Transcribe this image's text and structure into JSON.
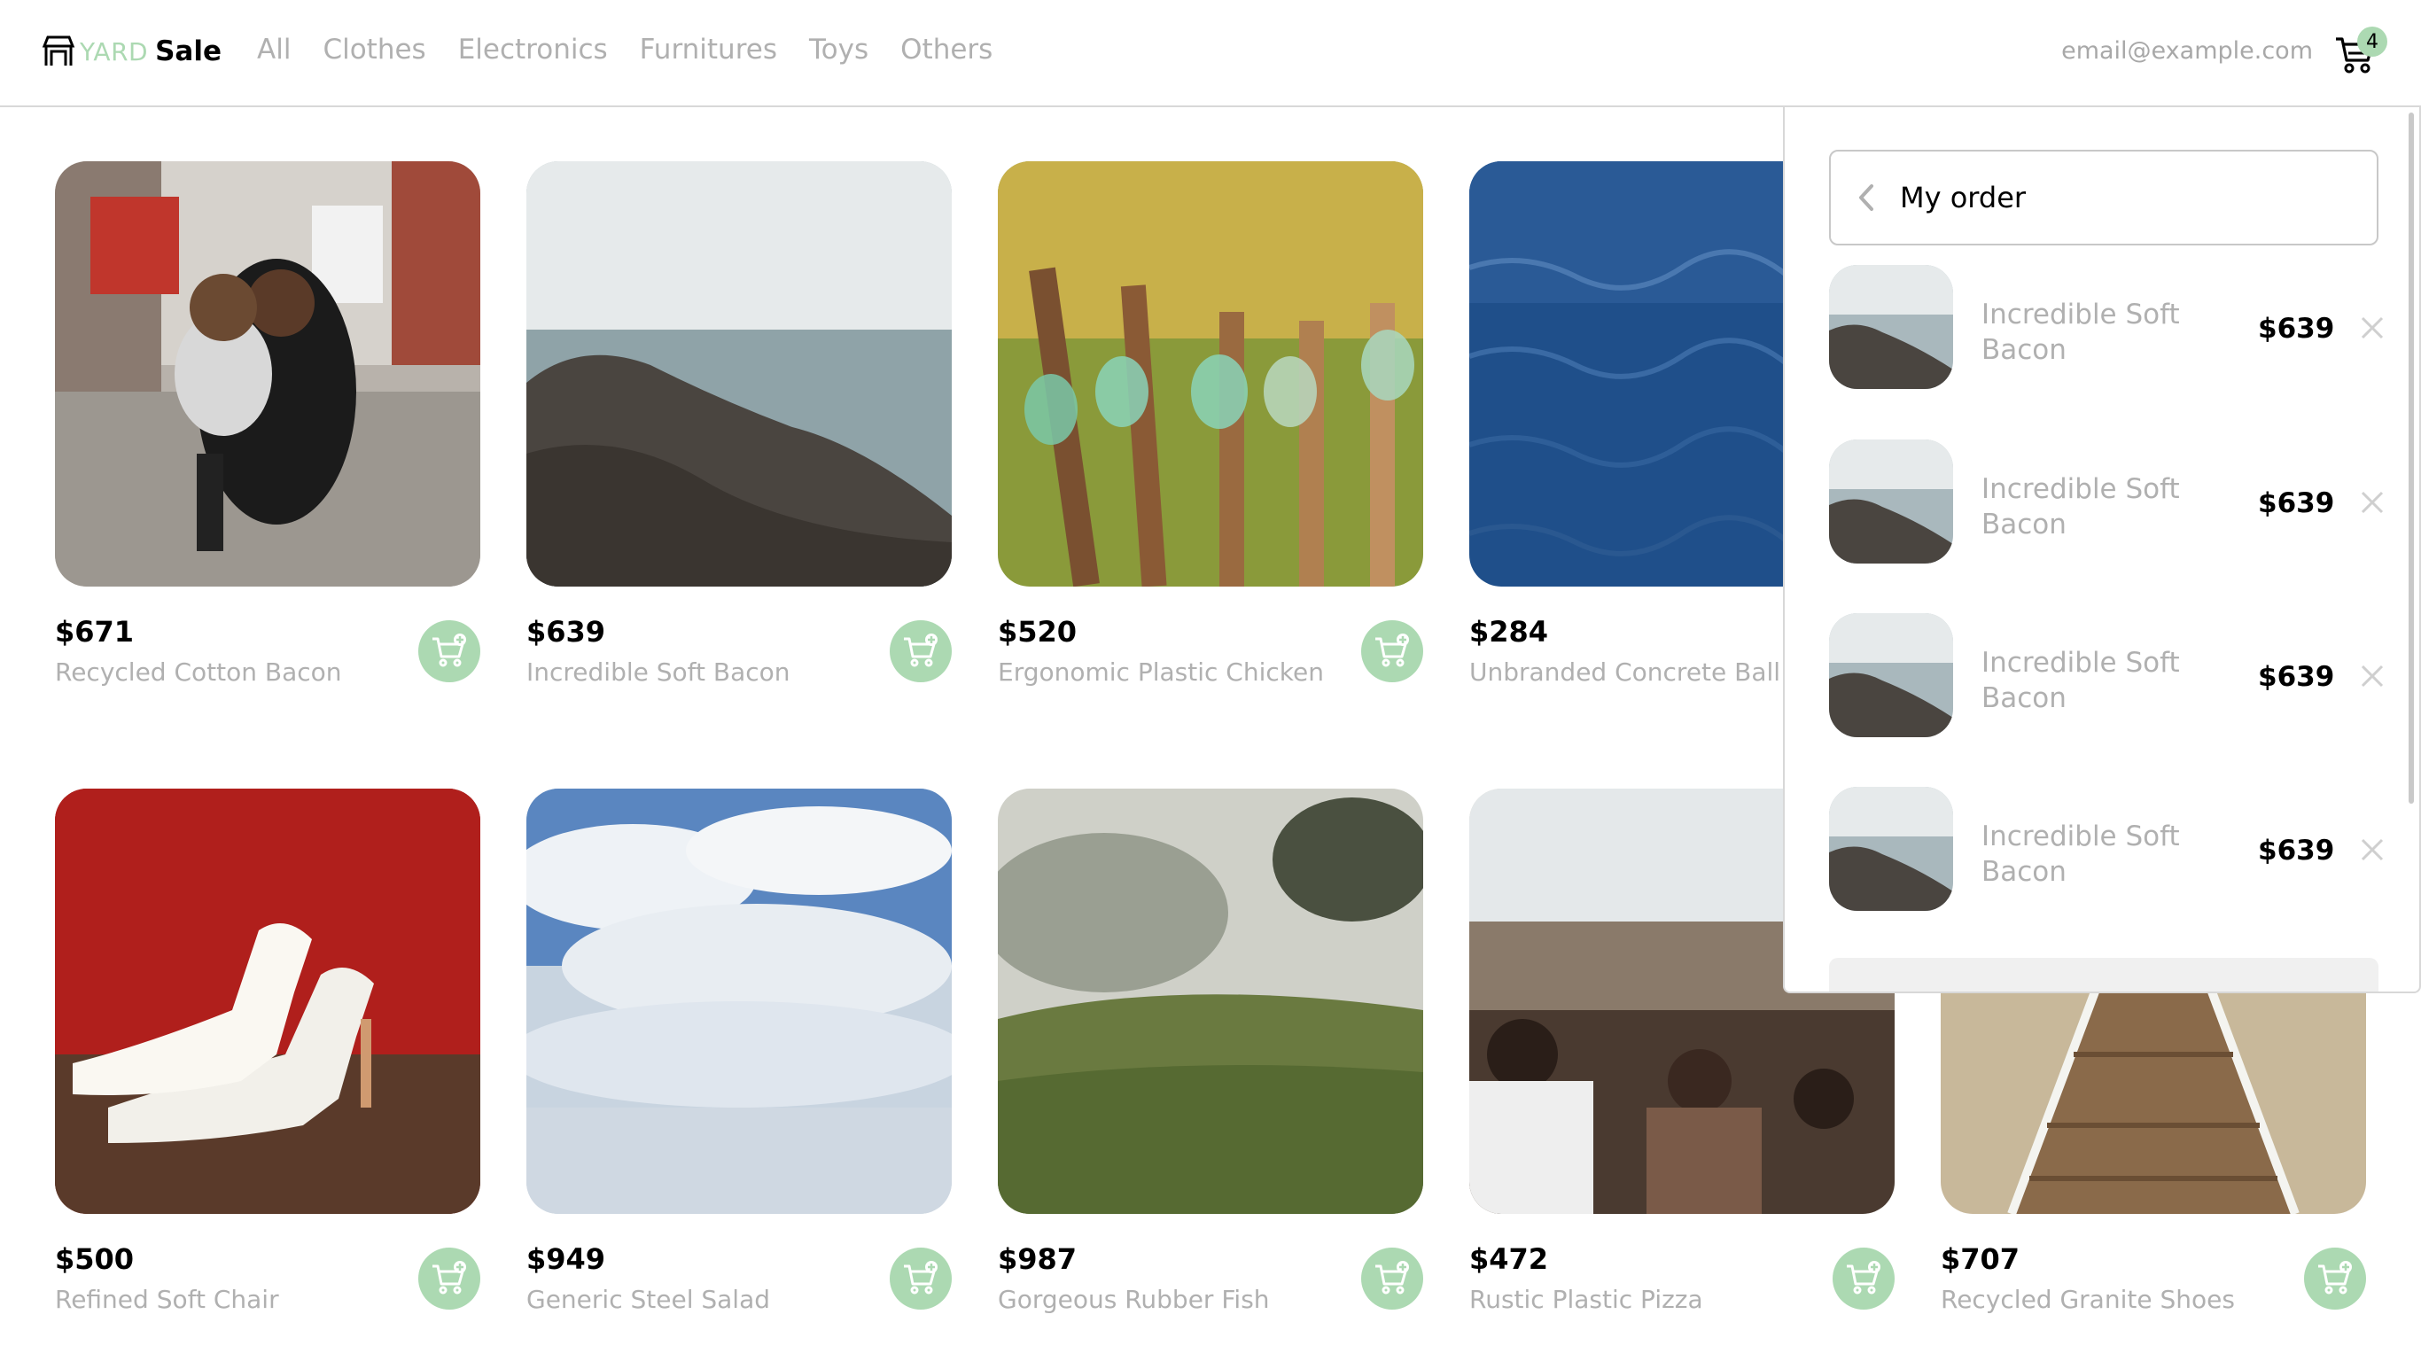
{
  "brand": {
    "yard": "YARD",
    "sale": "Sale"
  },
  "nav": {
    "links": [
      "All",
      "Clothes",
      "Electronics",
      "Furnitures",
      "Toys",
      "Others"
    ],
    "email": "email@example.com",
    "cart_count": "4"
  },
  "colors": {
    "accent": "#acd9b2",
    "muted_text": "#b0b0b0",
    "border": "#d8d8d8"
  },
  "products": [
    {
      "price": "$671",
      "name": "Recycled Cotton Bacon",
      "image": "mother-child-street-photo"
    },
    {
      "price": "$639",
      "name": "Incredible Soft Bacon",
      "image": "rocky-shore-photo"
    },
    {
      "price": "$520",
      "name": "Ergonomic Plastic Chicken",
      "image": "glass-jars-fence-photo"
    },
    {
      "price": "$284",
      "name": "Unbranded Concrete Ball",
      "image": "ocean-water-photo"
    },
    {
      "price": "",
      "name": "",
      "image": "hidden-behind-panel"
    },
    {
      "price": "$500",
      "name": "Refined Soft Chair",
      "image": "white-heels-photo"
    },
    {
      "price": "$949",
      "name": "Generic Steel Salad",
      "image": "cloudy-sky-photo"
    },
    {
      "price": "$987",
      "name": "Gorgeous Rubber Fish",
      "image": "foggy-field-photo"
    },
    {
      "price": "$472",
      "name": "Rustic Plastic Pizza",
      "image": "boardwalk-crowd-photo"
    },
    {
      "price": "$707",
      "name": "Recycled Granite Shoes",
      "image": "wooden-pier-photo"
    }
  ],
  "order": {
    "title": "My order",
    "items": [
      {
        "name": "Incredible Soft Bacon",
        "price": "$639"
      },
      {
        "name": "Incredible Soft Bacon",
        "price": "$639"
      },
      {
        "name": "Incredible Soft Bacon",
        "price": "$639"
      },
      {
        "name": "Incredible Soft Bacon",
        "price": "$639"
      }
    ]
  },
  "icons": {
    "logo": "storefront-icon",
    "cart": "shopping-cart-icon",
    "add_to_cart": "add-to-cart-icon",
    "back": "chevron-left-icon",
    "remove": "close-icon"
  }
}
